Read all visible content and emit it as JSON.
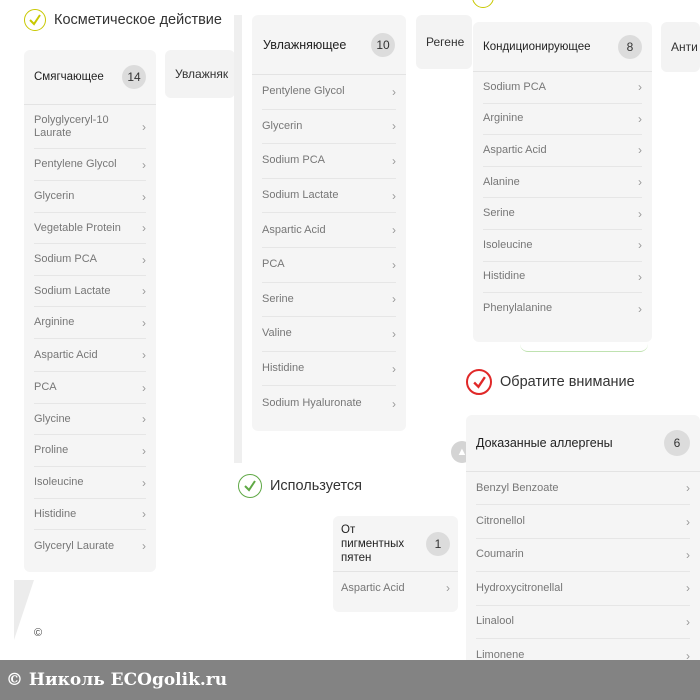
{
  "colors": {
    "accent_yellow": "#c8c800",
    "accent_green": "#5fa845",
    "accent_red": "#e02828",
    "card_bg": "#f5f5f5",
    "badge_bg": "#dcdcdc"
  },
  "section_cosmetic": {
    "title": "Косметическое действие"
  },
  "section_used": {
    "title": "Используется"
  },
  "section_attention": {
    "title": "Обратите внимание"
  },
  "tabs": {
    "moisturizing_partial": "Увлажняк",
    "regen_partial": "Регене",
    "anti_partial": "Анти"
  },
  "softening": {
    "title": "Смягчающее",
    "count": "14",
    "items": [
      "Polyglyceryl-10 Laurate",
      "Pentylene Glycol",
      "Glycerin",
      "Vegetable Protein",
      "Sodium PCA",
      "Sodium Lactate",
      "Arginine",
      "Aspartic Acid",
      "PCA",
      "Glycine",
      "Proline",
      "Isoleucine",
      "Histidine",
      "Glyceryl Laurate"
    ]
  },
  "moisturizing": {
    "title": "Увлажняющее",
    "count": "10",
    "items": [
      "Pentylene Glycol",
      "Glycerin",
      "Sodium PCA",
      "Sodium Lactate",
      "Aspartic Acid",
      "PCA",
      "Serine",
      "Valine",
      "Histidine",
      "Sodium Hyaluronate"
    ]
  },
  "conditioning": {
    "title": "Кондиционирующее",
    "count": "8",
    "items": [
      "Sodium PCA",
      "Arginine",
      "Aspartic Acid",
      "Alanine",
      "Serine",
      "Isoleucine",
      "Histidine",
      "Phenylalanine"
    ]
  },
  "pigment": {
    "title": "От пигментных пятен",
    "count": "1",
    "items": [
      "Aspartic Acid"
    ]
  },
  "allergens": {
    "title": "Доказанные аллергены",
    "count": "6",
    "items": [
      "Benzyl Benzoate",
      "Citronellol",
      "Coumarin",
      "Hydroxycitronellal",
      "Linalool",
      "Limonene"
    ]
  },
  "misc": {
    "stray_char": "©"
  },
  "watermark": {
    "text": "© Николь  ECOgolik.ru"
  }
}
